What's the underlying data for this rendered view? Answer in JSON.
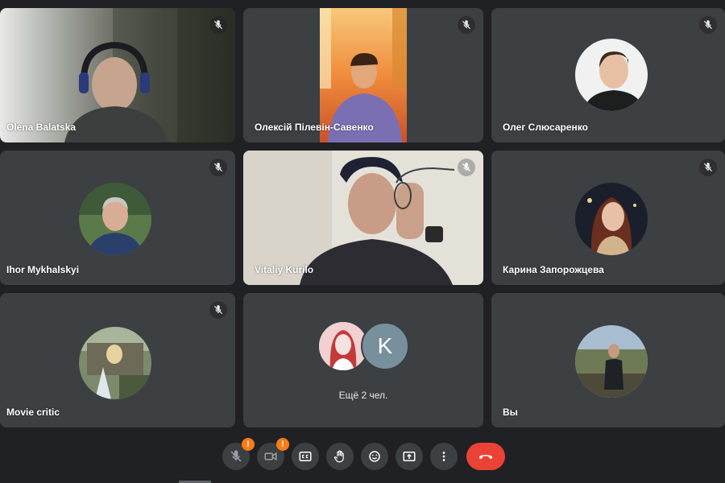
{
  "participants": [
    {
      "name": "Olena Balatska",
      "muted": true,
      "type": "video"
    },
    {
      "name": "Олексій Пілевін-Савенко",
      "muted": true,
      "type": "video"
    },
    {
      "name": "Олег Слюсаренко",
      "muted": true,
      "type": "avatar"
    },
    {
      "name": "Ihor Mykhalskyi",
      "muted": true,
      "type": "avatar"
    },
    {
      "name": "Vitaliy Kurilo",
      "muted": true,
      "type": "video"
    },
    {
      "name": "Карина Запорожцева",
      "muted": true,
      "type": "avatar"
    },
    {
      "name": "Movie critic",
      "muted": true,
      "type": "avatar"
    }
  ],
  "more_tile": {
    "avatar_letter": "K",
    "label": "Ещё 2 чел."
  },
  "self_tile": {
    "name": "Вы"
  },
  "controls": {
    "mic_warning": "!",
    "camera_warning": "!",
    "buttons": [
      "mic",
      "camera",
      "captions",
      "raise-hand",
      "emoji",
      "present",
      "more",
      "end-call"
    ]
  },
  "colors": {
    "background": "#202124",
    "tile": "#3c4043",
    "end_call": "#ea4335",
    "warning": "#fa7b17",
    "k_avatar": "#78909c"
  }
}
